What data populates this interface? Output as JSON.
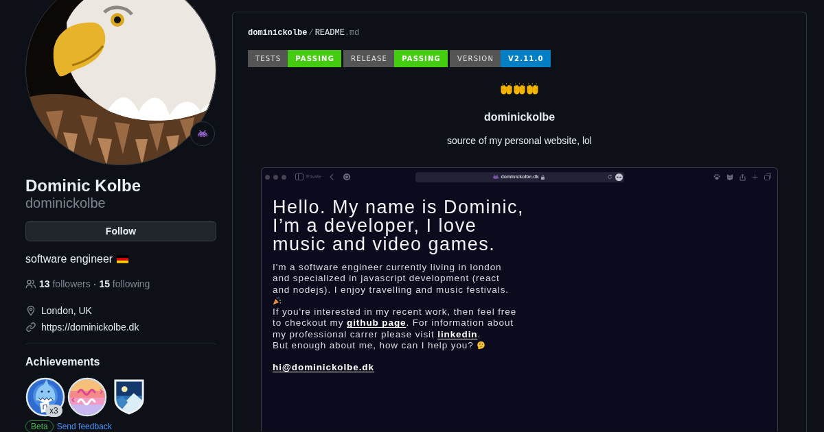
{
  "profile": {
    "name": "Dominic Kolbe",
    "username": "dominickolbe",
    "follow_button": "Follow",
    "bio": "software engineer",
    "followers": "**13** followers",
    "separator": "·",
    "following": "**15** following",
    "location": "London, UK",
    "website": "https://dominickolbe.dk",
    "achievements_title": "Achievements",
    "achievements": [
      {
        "kind": "shark",
        "count": "x3"
      },
      {
        "kind": "rainbow"
      },
      {
        "kind": "shield"
      }
    ],
    "beta_label": "Beta",
    "feedback_link": "Send feedback"
  },
  "readme": {
    "owner": "dominickolbe",
    "path_separator": "/",
    "file": "README",
    "extension": ".md",
    "badges": [
      {
        "label": "TESTS",
        "value": "PASSING",
        "color": "#44cc11"
      },
      {
        "label": "RELEASE",
        "value": "PASSING",
        "color": "#44cc11"
      },
      {
        "label": "VERSION",
        "value": "V2.11.0",
        "color": "#007ec6"
      }
    ],
    "title": "dominickolbe",
    "description": "source of my personal website, lol"
  },
  "screenshot": {
    "private_label": "Private",
    "url": "dominickolbe.dk",
    "heading": "Hello. My name is Dominic, I’m a developer, I love music and video games.",
    "about": [
      [
        {
          "kind": "text",
          "text": "I'm a software engineer currently living in london and specialized in javascript development (react and nodejs). I enjoy travelling and music festivals."
        }
      ],
      [
        {
          "kind": "text",
          "text": "If you're interested in my recent work, then feel free to checkout my "
        },
        {
          "kind": "link",
          "text": "github page"
        },
        {
          "kind": "text",
          "text": ". For information about my professional carrer please visit "
        },
        {
          "kind": "link",
          "text": "linkedin"
        },
        {
          "kind": "text",
          "text": "."
        }
      ],
      [
        {
          "kind": "text",
          "text": "But enough about me, how can I help you?"
        }
      ]
    ],
    "email": "hi@dominickolbe.dk"
  }
}
